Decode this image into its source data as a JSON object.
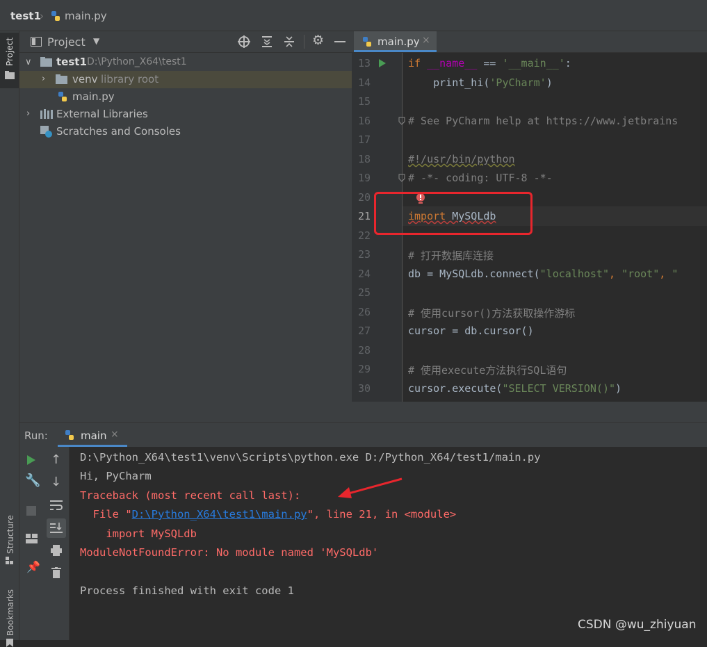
{
  "navbar": {
    "project": "test1",
    "file": "main.py"
  },
  "left_stripe": {
    "project_tab": "Project",
    "structure_tab": "Structure",
    "bookmarks_tab": "Bookmarks"
  },
  "project_panel": {
    "title": "Project",
    "tree": [
      {
        "name": "test1",
        "detail": "D:\\Python_X64\\test1"
      },
      {
        "name": "venv",
        "detail": "library root"
      },
      {
        "name": "main.py",
        "detail": ""
      },
      {
        "name": "External Libraries",
        "detail": ""
      },
      {
        "name": "Scratches and Consoles",
        "detail": ""
      }
    ]
  },
  "editor": {
    "tab": "main.py",
    "line_numbers": [
      "13",
      "14",
      "15",
      "16",
      "17",
      "18",
      "19",
      "20",
      "21",
      "22",
      "23",
      "24",
      "25",
      "26",
      "27",
      "28",
      "29",
      "30"
    ],
    "lines": {
      "l13_kw": "if",
      "l13_a": " ",
      "l13_dunder": "__name__",
      "l13_b": " == ",
      "l13_str": "'__main__'",
      "l13_c": ":",
      "l14_a": "    print_hi(",
      "l14_str": "'PyCharm'",
      "l14_b": ")",
      "l16": "# See PyCharm help at https://www.jetbrains",
      "l18": "#!/usr/bin/python",
      "l19": "# -*- coding: UTF-8 -*-",
      "l21_kw": "import",
      "l21_mod": " MySQLdb",
      "l23": "# 打开数据库连接",
      "l24_a": "db = MySQLdb.connect(",
      "l24_s1": "\"localhost\"",
      "l24_b": ", ",
      "l24_s2": "\"root\"",
      "l24_c": ", ",
      "l24_s3": "\"",
      "l26": "# 使用cursor()方法获取操作游标",
      "l27": "cursor = db.cursor()",
      "l29": "# 使用execute方法执行SQL语句",
      "l30_a": "cursor.execute(",
      "l30_str": "\"SELECT VERSION()\"",
      "l30_b": ")"
    }
  },
  "run": {
    "label": "Run:",
    "tab": "main",
    "console": {
      "cmd": "D:\\Python_X64\\test1\\venv\\Scripts\\python.exe D:/Python_X64/test1/main.py",
      "hi": "Hi, PyCharm",
      "traceback": "Traceback (most recent call last):",
      "file_pre": "  File \"",
      "file_link": "D:\\Python_X64\\test1\\main.py",
      "file_post": "\", line 21, in <module>",
      "import_line": "    import MySQLdb",
      "error": "ModuleNotFoundError: No module named 'MySQLdb'",
      "finished": "Process finished with exit code 1"
    }
  },
  "watermark": "CSDN @wu_zhiyuan",
  "colors": {
    "highlight_box": "#e8262d",
    "arrow": "#e8262d",
    "error_text": "#ff6b68",
    "link": "#287bde"
  }
}
